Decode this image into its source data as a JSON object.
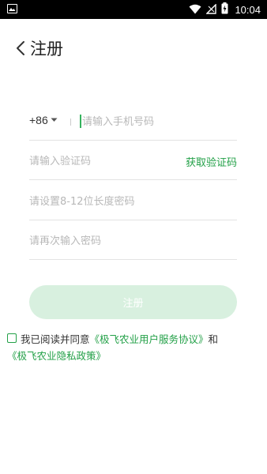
{
  "status_bar": {
    "time": "10:04",
    "icons": [
      "image-icon",
      "wifi-icon",
      "signal-icon",
      "battery-icon"
    ]
  },
  "header": {
    "title": "注册"
  },
  "form": {
    "country_code": "+86",
    "phone_placeholder": "请输入手机号码",
    "code_placeholder": "请输入验证码",
    "get_code_label": "获取验证码",
    "password_placeholder": "请设置8-12位长度密码",
    "confirm_password_placeholder": "请再次输入密码"
  },
  "register_button": {
    "label": "注册"
  },
  "agreement": {
    "prefix": "我已阅读并同意",
    "user_agreement": "《极飞农业用户服务协议》",
    "conjunction": "和",
    "privacy_policy": "《极飞农业隐私政策》",
    "checked": false
  },
  "colors": {
    "accent": "#22a047",
    "button_disabled": "#d8f0df",
    "status_bar": "#000000"
  }
}
